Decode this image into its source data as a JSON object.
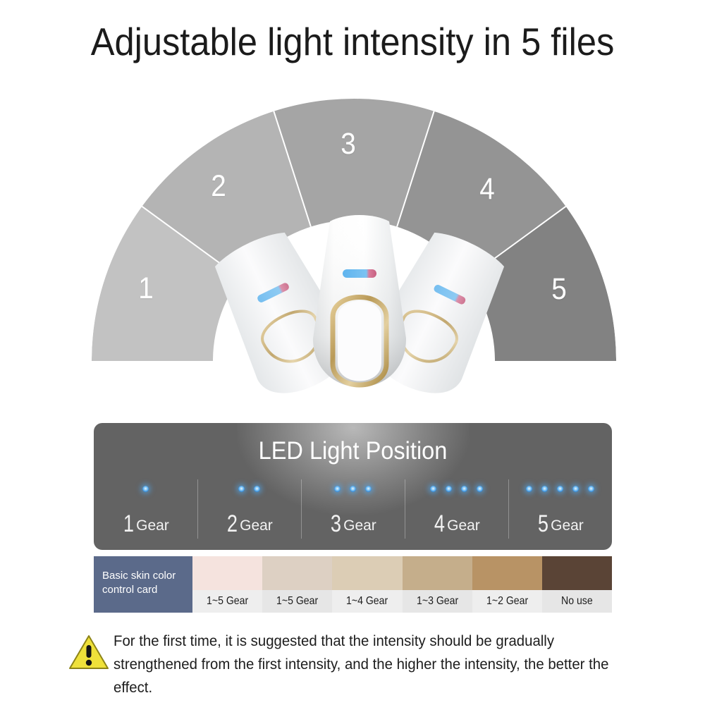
{
  "title": "Adjustable light intensity in 5 files",
  "gauge": {
    "segments": [
      {
        "label": "1",
        "color": "#c2c2c2"
      },
      {
        "label": "2",
        "color": "#b4b4b4"
      },
      {
        "label": "3",
        "color": "#a5a5a5"
      },
      {
        "label": "4",
        "color": "#949494"
      },
      {
        "label": "5",
        "color": "#828282"
      }
    ]
  },
  "product": {
    "name": "ipl-hair-removal-device",
    "body_color": "#ffffff",
    "accent_color": "#c8a96a",
    "indicator_color": "#4aa3e8"
  },
  "led_panel": {
    "heading": "LED Light Position",
    "panel_color": "#636363",
    "led_color": "#4aa3e8",
    "gears": [
      {
        "number": "1",
        "word": "Gear",
        "dots": 1
      },
      {
        "number": "2",
        "word": "Gear",
        "dots": 2
      },
      {
        "number": "3",
        "word": "Gear",
        "dots": 3
      },
      {
        "number": "4",
        "word": "Gear",
        "dots": 4
      },
      {
        "number": "5",
        "word": "Gear",
        "dots": 5
      }
    ]
  },
  "skin_card": {
    "label_line1": "Basic skin color",
    "label_line2": "control card",
    "label_bg": "#5b6a8a",
    "swatches": [
      {
        "color": "#f5e3de",
        "caption": "1~5 Gear"
      },
      {
        "color": "#ddd0c3",
        "caption": "1~5 Gear"
      },
      {
        "color": "#dccdb5",
        "caption": "1~4 Gear"
      },
      {
        "color": "#c5ae8b",
        "caption": "1~3 Gear"
      },
      {
        "color": "#b89365",
        "caption": "1~2 Gear"
      },
      {
        "color": "#5a4436",
        "caption": "No use"
      }
    ]
  },
  "footnote": {
    "icon": "warning-triangle-icon",
    "icon_color": "#efe13a",
    "text": "For the first time, it is suggested that the intensity should be gradually strengthened from the first intensity, and the higher the intensity, the better the effect."
  }
}
